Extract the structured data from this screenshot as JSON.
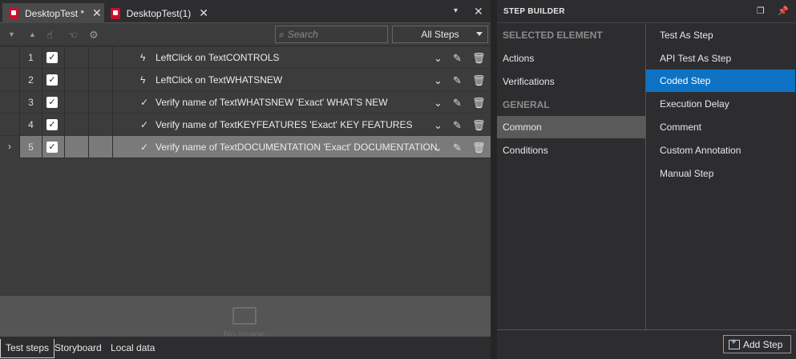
{
  "tabs": [
    {
      "label": "DesktopTest *",
      "active": true
    },
    {
      "label": "DesktopTest(1)",
      "active": false
    }
  ],
  "toolbar": {
    "search_placeholder": "Search",
    "filter_value": "All Steps"
  },
  "steps": [
    {
      "number": "1",
      "checked": true,
      "icon": "bolt-icon",
      "text": "LeftClick on TextCONTROLS",
      "selected": false
    },
    {
      "number": "2",
      "checked": true,
      "icon": "bolt-icon",
      "text": "LeftClick on TextWHATSNEW",
      "selected": false
    },
    {
      "number": "3",
      "checked": true,
      "icon": "verify-check-icon",
      "text": "Verify name of TextWHATSNEW 'Exact' WHAT'S NEW",
      "selected": false
    },
    {
      "number": "4",
      "checked": true,
      "icon": "verify-check-icon",
      "text": "Verify name of TextKEYFEATURES 'Exact' KEY FEATURES",
      "selected": false
    },
    {
      "number": "5",
      "checked": true,
      "icon": "verify-check-icon",
      "text": "Verify name of TextDOCUMENTATION 'Exact' DOCUMENTATION",
      "selected": true
    }
  ],
  "preview": {
    "no_image_text": "No image"
  },
  "bottom_tabs": [
    {
      "label": "Test steps",
      "active": true
    },
    {
      "label": "Storyboard",
      "active": false
    },
    {
      "label": "Local data",
      "active": false
    }
  ],
  "step_builder": {
    "title": "STEP BUILDER",
    "categories": [
      {
        "label": "SELECTED ELEMENT",
        "header": true,
        "selected": false
      },
      {
        "label": "Actions",
        "header": false,
        "selected": false
      },
      {
        "label": "Verifications",
        "header": false,
        "selected": false
      },
      {
        "label": "GENERAL",
        "header": true,
        "selected": false
      },
      {
        "label": "Common",
        "header": false,
        "selected": true
      },
      {
        "label": "Conditions",
        "header": false,
        "selected": false
      }
    ],
    "items": [
      {
        "label": "Test As Step",
        "selected": false
      },
      {
        "label": "API Test As Step",
        "selected": false
      },
      {
        "label": "Coded Step",
        "selected": true
      },
      {
        "label": "Execution Delay",
        "selected": false
      },
      {
        "label": "Comment",
        "selected": false
      },
      {
        "label": "Custom Annotation",
        "selected": false
      },
      {
        "label": "Manual Step",
        "selected": false
      }
    ],
    "add_button": "Add Step"
  },
  "colors": {
    "selection_blue": "#0e72c4",
    "selected_row": "#7a7a7a",
    "tab_icon_red": "#c8102e"
  }
}
